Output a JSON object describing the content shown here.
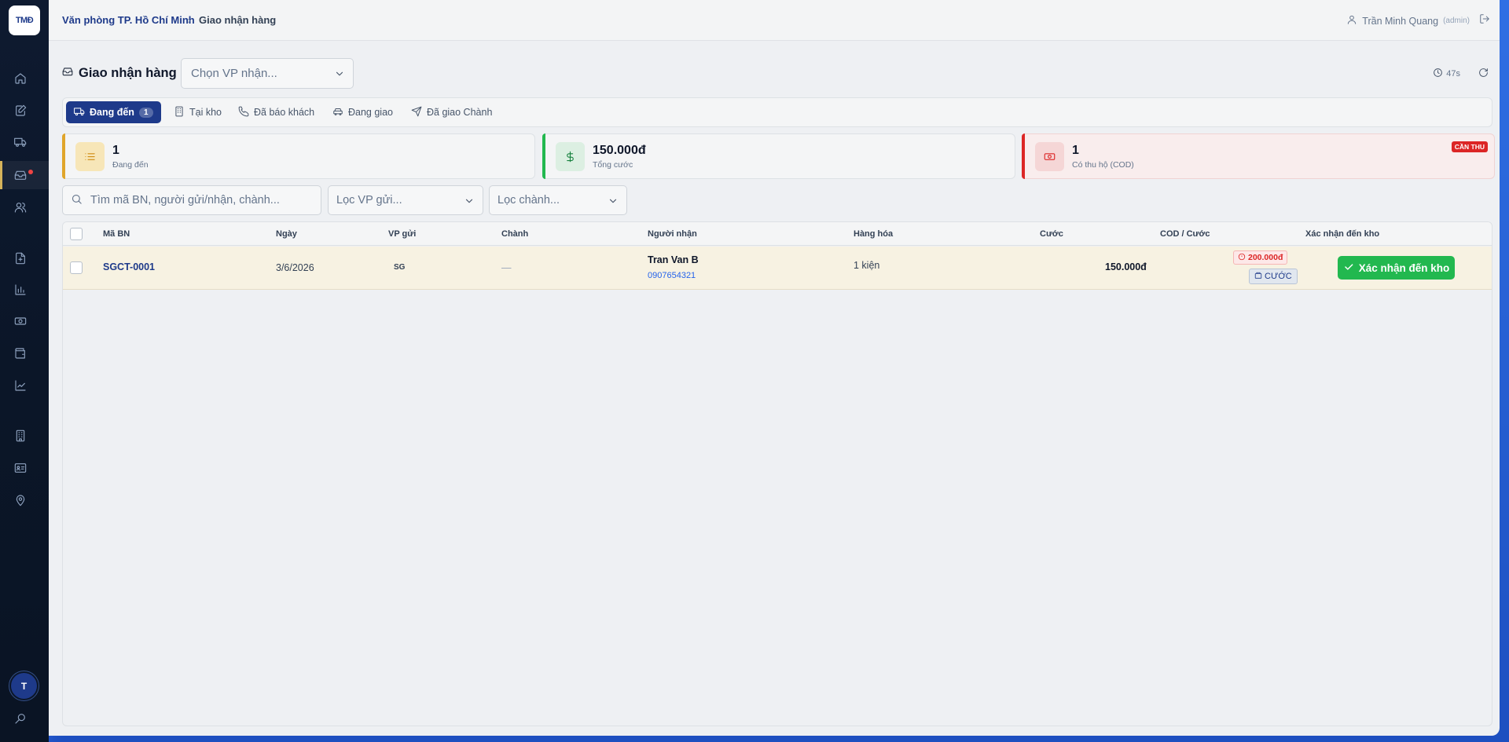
{
  "app": {
    "logo_text": "TMĐ",
    "accent": "#1e3a8a",
    "success": "#22b84f",
    "danger": "#dc2626"
  },
  "sidebar": {
    "items": [
      {
        "name": "home",
        "icon": "home-icon"
      },
      {
        "name": "create",
        "icon": "edit-icon"
      },
      {
        "name": "transport",
        "icon": "truck-icon"
      },
      {
        "name": "receive",
        "icon": "inbox-icon",
        "active": true,
        "has_alert": true
      },
      {
        "name": "customers",
        "icon": "users-icon"
      },
      {
        "name": "documents",
        "icon": "file-icon"
      },
      {
        "name": "reports",
        "icon": "bar-chart-icon"
      },
      {
        "name": "cash",
        "icon": "banknote-icon"
      },
      {
        "name": "wallet",
        "icon": "wallet-icon"
      },
      {
        "name": "trends",
        "icon": "trend-icon"
      },
      {
        "name": "offices",
        "icon": "building-icon"
      },
      {
        "name": "staff",
        "icon": "id-card-icon"
      },
      {
        "name": "locations",
        "icon": "map-pin-icon"
      }
    ],
    "avatar_initial": "T"
  },
  "header": {
    "breadcrumb": [
      "Văn phòng TP. Hồ Chí Minh",
      "Giao nhận hàng"
    ],
    "user_name": "Trần Minh Quang",
    "user_role": "(admin)"
  },
  "page": {
    "title": "Giao nhận hàng",
    "vp_select_placeholder": "Chọn VP nhận...",
    "timer": "47s"
  },
  "tabs": [
    {
      "label": "Đang đến",
      "badge": "1",
      "icon": "truck-icon",
      "active": true
    },
    {
      "label": "Tại kho",
      "icon": "building-icon"
    },
    {
      "label": "Đã báo khách",
      "icon": "phone-icon"
    },
    {
      "label": "Đang giao",
      "icon": "car-icon"
    },
    {
      "label": "Đã giao Chành",
      "icon": "send-icon"
    }
  ],
  "stats": [
    {
      "value": "1",
      "label": "Đang đến",
      "color": "#e0a52a",
      "icon": "list-icon"
    },
    {
      "value": "150.000đ",
      "label": "Tổng cước",
      "color": "#22b84f",
      "icon": "dollar-icon"
    },
    {
      "value": "1",
      "label": "Có thu hộ (COD)",
      "color": "#dc2626",
      "icon": "banknote-icon",
      "tag": "CẦN THU"
    }
  ],
  "filters": {
    "search_placeholder": "Tìm mã BN, người gửi/nhận, chành...",
    "vp_filter": "Lọc VP gửi...",
    "chanh_filter": "Lọc chành..."
  },
  "table": {
    "columns": [
      "Mã BN",
      "Ngày",
      "VP gửi",
      "Chành",
      "Người nhận",
      "Hàng hóa",
      "Cước",
      "COD / Cước",
      "Xác nhận đến kho"
    ],
    "rows": [
      {
        "code": "SGCT-0001",
        "date": "3/6/2026",
        "vp": "SG",
        "chanh": "—",
        "receiver_name": "Tran Van B",
        "receiver_phone": "0907654321",
        "goods": "1 kiện",
        "fee": "150.000đ",
        "cod": "200.000đ",
        "cod_type": "CƯỚC",
        "action_label": "Xác nhận đến kho"
      }
    ]
  }
}
